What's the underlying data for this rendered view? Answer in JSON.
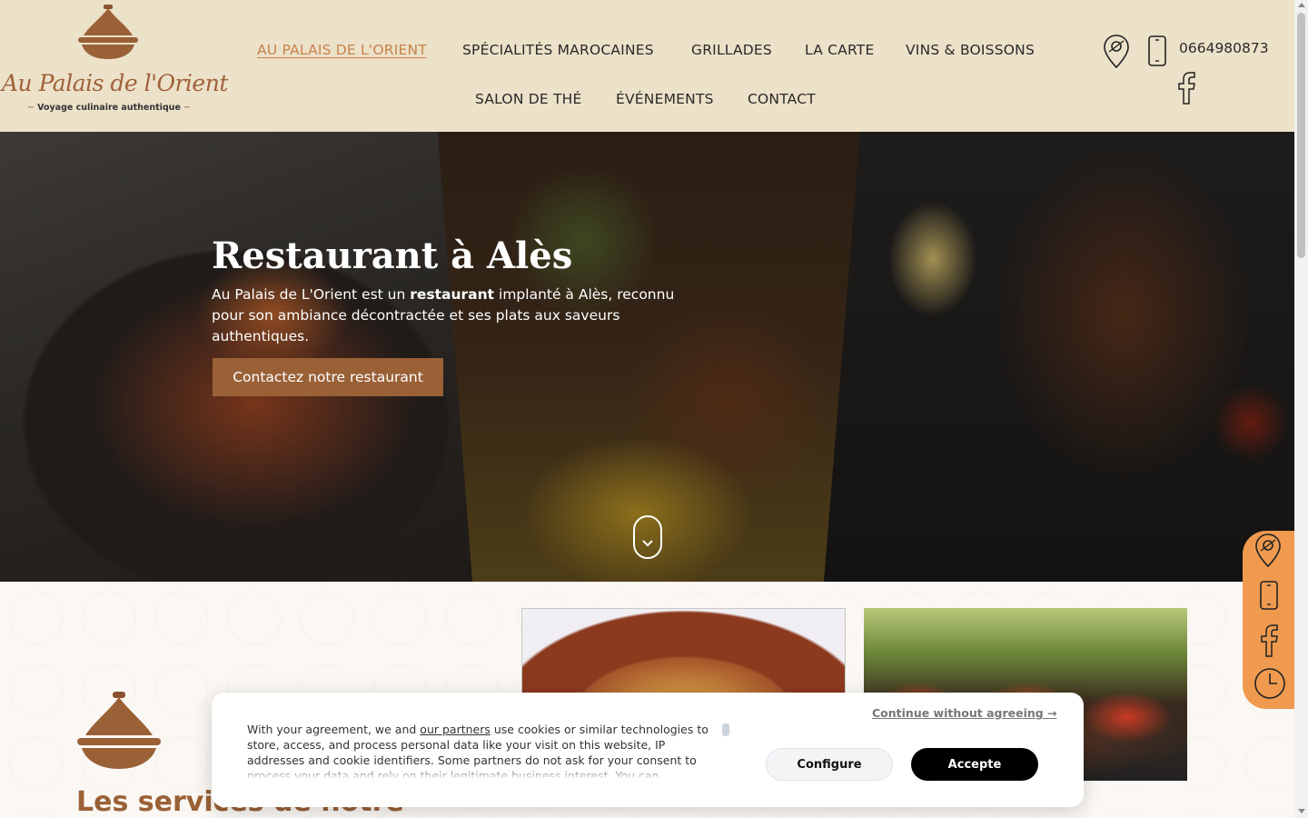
{
  "brand": {
    "name": "Au Palais de l'Orient",
    "tagline": "Voyage culinaire authentique",
    "primary_color": "#9a6137",
    "header_bg": "#ece1c9",
    "accent_orange": "#ef9a4f"
  },
  "nav": {
    "items": [
      {
        "label": "AU PALAIS DE L'ORIENT",
        "active": true
      },
      {
        "label": "SPÉCIALITÉS MAROCAINES"
      },
      {
        "label": "GRILLADES"
      },
      {
        "label": "LA CARTE"
      },
      {
        "label": "VINS & BOISSONS"
      },
      {
        "label": "SALON DE THÉ"
      },
      {
        "label": "ÉVÉNEMENTS"
      },
      {
        "label": "CONTACT"
      }
    ]
  },
  "header_contact": {
    "phone": "0664980873",
    "icons": [
      "map-pin-icon",
      "phone-icon",
      "facebook-icon"
    ]
  },
  "hero": {
    "title": "Restaurant à Alès",
    "text_before": "Au Palais de L'Orient est un ",
    "text_bold": "restaurant",
    "text_after": " implanté à Alès, reconnu pour son ambiance décontractée et ses plats aux saveurs authentiques.",
    "button": "Contactez notre restaurant"
  },
  "side_tab": {
    "icons": [
      "map-pin-icon",
      "phone-icon",
      "facebook-icon",
      "clock-icon"
    ]
  },
  "services": {
    "title": "Les services de notre"
  },
  "cookie": {
    "text_before": "With your agreement, we and ",
    "partners_link": "our partners",
    "text_after": " use cookies or similar technologies to store, access, and process personal data like your visit on this website, IP addresses and cookie identifiers. Some partners do not ask for your consent to process your data and rely on their legitimate business interest. You can",
    "continue_link": "Continue without agreeing →",
    "configure": "Configure",
    "accept": "Accepte"
  }
}
